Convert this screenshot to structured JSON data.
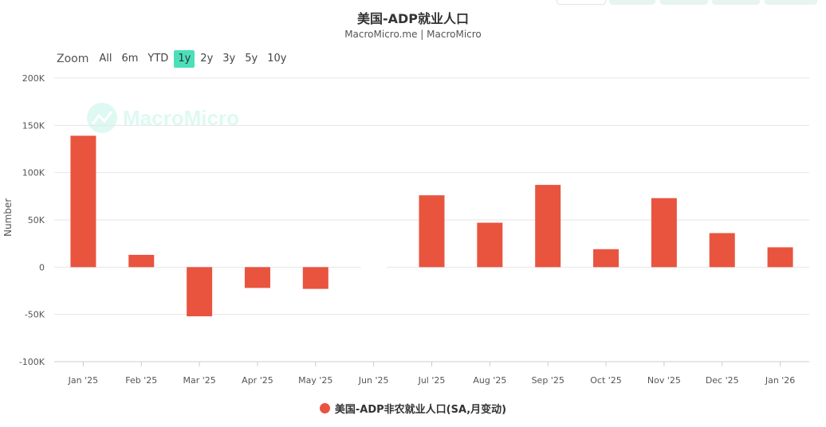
{
  "header": {
    "title": "美国-ADP就业人口",
    "subtitle": "MacroMicro.me | MacroMicro"
  },
  "zoom": {
    "label": "Zoom",
    "options": [
      "All",
      "6m",
      "YTD",
      "1y",
      "2y",
      "3y",
      "5y",
      "10y"
    ],
    "selected": "1y"
  },
  "watermark": {
    "text": "MacroMicro",
    "icon": "macromicro-logo-icon"
  },
  "colors": {
    "accent": "#4be0b9",
    "series": "#e9543f",
    "grid": "#e6e6e6"
  },
  "chart_data": {
    "type": "bar",
    "title": "美国-ADP就业人口",
    "subtitle": "MacroMicro.me | MacroMicro",
    "ylabel": "Number",
    "xlabel": "",
    "ylim": [
      -100000,
      200000
    ],
    "yticks": [
      200000,
      150000,
      100000,
      50000,
      0,
      -50000,
      -100000
    ],
    "ytick_labels": [
      "200K",
      "150K",
      "100K",
      "50K",
      "0",
      "-50K",
      "-100K"
    ],
    "categories": [
      "Jan '25",
      "Feb '25",
      "Mar '25",
      "Apr '25",
      "May '25",
      "Jun '25",
      "Jul '25",
      "Aug '25",
      "Sep '25",
      "Oct '25",
      "Nov '25",
      "Dec '25",
      "Jan '26"
    ],
    "grid": true,
    "legend_position": "bottom",
    "series": [
      {
        "name": "美国-ADP非农就业人口(SA,月变动)",
        "color": "#e9543f",
        "values": [
          139000,
          13000,
          -52000,
          -22000,
          -23000,
          null,
          76000,
          47000,
          87000,
          19000,
          73000,
          36000,
          21000
        ]
      }
    ]
  }
}
